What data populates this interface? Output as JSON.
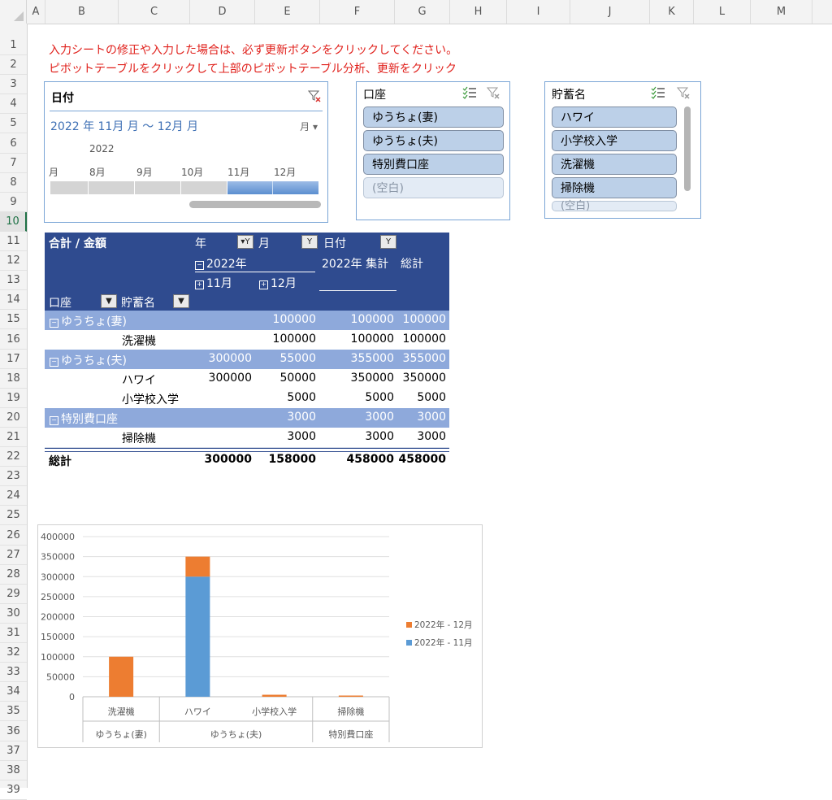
{
  "columns": [
    "A",
    "B",
    "C",
    "D",
    "E",
    "F",
    "G",
    "H",
    "I",
    "J",
    "K",
    "L",
    "M"
  ],
  "rows": [
    "1",
    "2",
    "3",
    "4",
    "5",
    "6",
    "7",
    "8",
    "9",
    "10",
    "11",
    "12",
    "13",
    "14",
    "15",
    "16",
    "17",
    "18",
    "19",
    "20",
    "21",
    "22",
    "23",
    "24",
    "25",
    "26",
    "27",
    "28",
    "29",
    "30",
    "31",
    "32",
    "33",
    "34",
    "35",
    "36",
    "37",
    "38",
    "39"
  ],
  "notes": {
    "line1": "入力シートの修正や入力した場合は、必ず更新ボタンをクリックしてください。",
    "line2": "ピボットテーブルをクリックして上部のピボットテーブル分析、更新をクリック"
  },
  "timeline": {
    "title": "日付",
    "range": "2022 年 11月 月 〜 12月 月",
    "level": "月 ▾",
    "year": "2022",
    "months": [
      "月",
      "8月",
      "9月",
      "10月",
      "11月",
      "12月"
    ]
  },
  "slicer_account": {
    "title": "口座",
    "items": [
      "ゆうちょ(妻)",
      "ゆうちょ(夫)",
      "特別費口座",
      "(空白)"
    ]
  },
  "slicer_savings": {
    "title": "貯蓄名",
    "items": [
      "ハワイ",
      "小学校入学",
      "洗濯機",
      "掃除機",
      "(空白)"
    ]
  },
  "pivot": {
    "value_label": "合計 / 金額",
    "field_year": "年",
    "field_month": "月",
    "field_date": "日付",
    "year_2022": "2022年",
    "year_total": "2022年 集計",
    "grand_total_label": "総計",
    "m11": "11月",
    "m12": "12月",
    "row_field1": "口座",
    "row_field2": "貯蓄名",
    "rows": [
      {
        "label": "ゆうちょ(妻)",
        "group": true,
        "c11": "",
        "c12": "100000",
        "ytot": "100000",
        "gt": "100000"
      },
      {
        "label": "洗濯機",
        "group": false,
        "c11": "",
        "c12": "100000",
        "ytot": "100000",
        "gt": "100000"
      },
      {
        "label": "ゆうちょ(夫)",
        "group": true,
        "c11": "300000",
        "c12": "55000",
        "ytot": "355000",
        "gt": "355000"
      },
      {
        "label": "ハワイ",
        "group": false,
        "c11": "300000",
        "c12": "50000",
        "ytot": "350000",
        "gt": "350000"
      },
      {
        "label": "小学校入学",
        "group": false,
        "c11": "",
        "c12": "5000",
        "ytot": "5000",
        "gt": "5000"
      },
      {
        "label": "特別費口座",
        "group": true,
        "c11": "",
        "c12": "3000",
        "ytot": "3000",
        "gt": "3000"
      },
      {
        "label": "掃除機",
        "group": false,
        "c11": "",
        "c12": "3000",
        "ytot": "3000",
        "gt": "3000"
      }
    ],
    "grand": {
      "label": "総計",
      "c11": "300000",
      "c12": "158000",
      "ytot": "458000",
      "gt": "458000"
    }
  },
  "chart_data": {
    "type": "bar",
    "stacked": true,
    "categories": [
      "洗濯機",
      "ハワイ",
      "小学校入学",
      "掃除機"
    ],
    "groups": [
      {
        "label": "ゆうちょ(妻)",
        "categories": [
          "洗濯機"
        ]
      },
      {
        "label": "ゆうちょ(夫)",
        "categories": [
          "ハワイ",
          "小学校入学"
        ]
      },
      {
        "label": "特別費口座",
        "categories": [
          "掃除機"
        ]
      }
    ],
    "series": [
      {
        "name": "2022年 - 11月",
        "color": "#5b9bd5",
        "values": [
          0,
          300000,
          0,
          0
        ]
      },
      {
        "name": "2022年 - 12月",
        "color": "#ed7d31",
        "values": [
          100000,
          50000,
          5000,
          3000
        ]
      }
    ],
    "yticks": [
      "0",
      "50000",
      "100000",
      "150000",
      "200000",
      "250000",
      "300000",
      "350000",
      "400000"
    ],
    "ylim": [
      0,
      400000
    ],
    "legend": "right",
    "grid": true
  },
  "colors": {
    "pivot_header": "#2f4b8f",
    "pivot_group": "#8ea9db",
    "slicer_border": "#7aa5d6",
    "selection": "#1e7145"
  }
}
